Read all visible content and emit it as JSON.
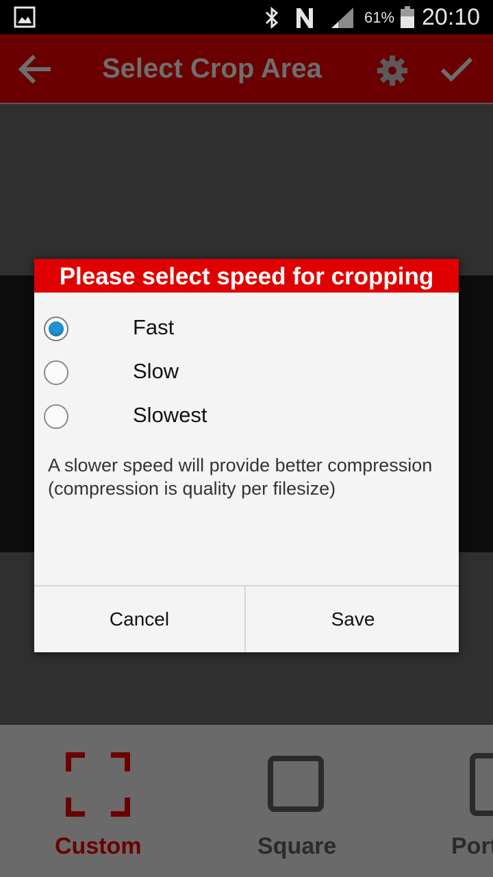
{
  "status_bar": {
    "battery_percent": "61%",
    "time": "20:10",
    "icons": [
      "gallery-icon",
      "bluetooth-icon",
      "nfc-icon",
      "signal-icon",
      "battery-icon"
    ]
  },
  "app_bar": {
    "title": "Select Crop Area",
    "icons": [
      "back-arrow-icon",
      "gear-icon",
      "check-icon"
    ]
  },
  "dialog": {
    "title": "Please select speed for cropping",
    "options": [
      {
        "label": "Fast",
        "selected": true
      },
      {
        "label": "Slow",
        "selected": false
      },
      {
        "label": "Slowest",
        "selected": false
      }
    ],
    "hint": "A slower speed will provide better compression (compression is quality per filesize)",
    "cancel_label": "Cancel",
    "save_label": "Save"
  },
  "toolbar": {
    "items": [
      {
        "label": "Custom",
        "icon": "custom-crop-icon",
        "active": true
      },
      {
        "label": "Square",
        "icon": "square-crop-icon",
        "active": false
      },
      {
        "label": "Portrait",
        "icon": "portrait-crop-icon",
        "active": false
      }
    ]
  },
  "colors": {
    "accent": "#e00000",
    "radio_selected": "#1f93d2"
  }
}
